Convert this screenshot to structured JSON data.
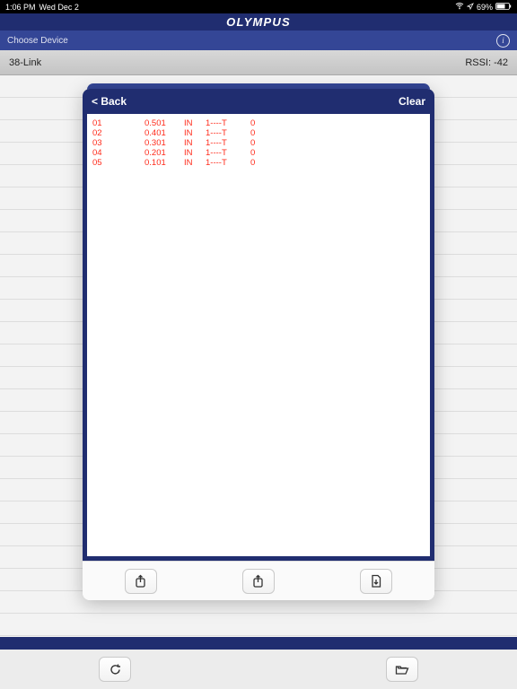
{
  "status": {
    "time": "1:06 PM",
    "date": "Wed Dec 2",
    "battery": "69%"
  },
  "header": {
    "logo": "OLYMPUS",
    "choose_label": "Choose Device"
  },
  "device": {
    "name": "38-Link",
    "rssi": "RSSI: -42"
  },
  "modal": {
    "back": "< Back",
    "clear": "Clear"
  },
  "rows": [
    {
      "id": "01",
      "val": "0.501",
      "unit": "IN",
      "code": "1----T",
      "flag": "0"
    },
    {
      "id": "02",
      "val": "0.401",
      "unit": "IN",
      "code": "1----T",
      "flag": "0"
    },
    {
      "id": "03",
      "val": "0.301",
      "unit": "IN",
      "code": "1----T",
      "flag": "0"
    },
    {
      "id": "04",
      "val": "0.201",
      "unit": "IN",
      "code": "1----T",
      "flag": "0"
    },
    {
      "id": "05",
      "val": "0.101",
      "unit": "IN",
      "code": "1----T",
      "flag": "0"
    }
  ]
}
